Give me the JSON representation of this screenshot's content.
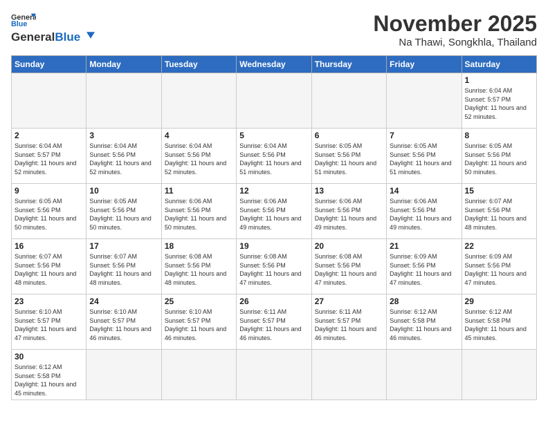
{
  "header": {
    "logo_general": "General",
    "logo_blue": "Blue",
    "month_year": "November 2025",
    "location": "Na Thawi, Songkhla, Thailand"
  },
  "weekdays": [
    "Sunday",
    "Monday",
    "Tuesday",
    "Wednesday",
    "Thursday",
    "Friday",
    "Saturday"
  ],
  "days": {
    "1": {
      "sunrise": "6:04 AM",
      "sunset": "5:57 PM",
      "daylight": "11 hours and 52 minutes."
    },
    "2": {
      "sunrise": "6:04 AM",
      "sunset": "5:57 PM",
      "daylight": "11 hours and 52 minutes."
    },
    "3": {
      "sunrise": "6:04 AM",
      "sunset": "5:56 PM",
      "daylight": "11 hours and 52 minutes."
    },
    "4": {
      "sunrise": "6:04 AM",
      "sunset": "5:56 PM",
      "daylight": "11 hours and 52 minutes."
    },
    "5": {
      "sunrise": "6:04 AM",
      "sunset": "5:56 PM",
      "daylight": "11 hours and 51 minutes."
    },
    "6": {
      "sunrise": "6:05 AM",
      "sunset": "5:56 PM",
      "daylight": "11 hours and 51 minutes."
    },
    "7": {
      "sunrise": "6:05 AM",
      "sunset": "5:56 PM",
      "daylight": "11 hours and 51 minutes."
    },
    "8": {
      "sunrise": "6:05 AM",
      "sunset": "5:56 PM",
      "daylight": "11 hours and 50 minutes."
    },
    "9": {
      "sunrise": "6:05 AM",
      "sunset": "5:56 PM",
      "daylight": "11 hours and 50 minutes."
    },
    "10": {
      "sunrise": "6:05 AM",
      "sunset": "5:56 PM",
      "daylight": "11 hours and 50 minutes."
    },
    "11": {
      "sunrise": "6:06 AM",
      "sunset": "5:56 PM",
      "daylight": "11 hours and 50 minutes."
    },
    "12": {
      "sunrise": "6:06 AM",
      "sunset": "5:56 PM",
      "daylight": "11 hours and 49 minutes."
    },
    "13": {
      "sunrise": "6:06 AM",
      "sunset": "5:56 PM",
      "daylight": "11 hours and 49 minutes."
    },
    "14": {
      "sunrise": "6:06 AM",
      "sunset": "5:56 PM",
      "daylight": "11 hours and 49 minutes."
    },
    "15": {
      "sunrise": "6:07 AM",
      "sunset": "5:56 PM",
      "daylight": "11 hours and 48 minutes."
    },
    "16": {
      "sunrise": "6:07 AM",
      "sunset": "5:56 PM",
      "daylight": "11 hours and 48 minutes."
    },
    "17": {
      "sunrise": "6:07 AM",
      "sunset": "5:56 PM",
      "daylight": "11 hours and 48 minutes."
    },
    "18": {
      "sunrise": "6:08 AM",
      "sunset": "5:56 PM",
      "daylight": "11 hours and 48 minutes."
    },
    "19": {
      "sunrise": "6:08 AM",
      "sunset": "5:56 PM",
      "daylight": "11 hours and 47 minutes."
    },
    "20": {
      "sunrise": "6:08 AM",
      "sunset": "5:56 PM",
      "daylight": "11 hours and 47 minutes."
    },
    "21": {
      "sunrise": "6:09 AM",
      "sunset": "5:56 PM",
      "daylight": "11 hours and 47 minutes."
    },
    "22": {
      "sunrise": "6:09 AM",
      "sunset": "5:56 PM",
      "daylight": "11 hours and 47 minutes."
    },
    "23": {
      "sunrise": "6:10 AM",
      "sunset": "5:57 PM",
      "daylight": "11 hours and 47 minutes."
    },
    "24": {
      "sunrise": "6:10 AM",
      "sunset": "5:57 PM",
      "daylight": "11 hours and 46 minutes."
    },
    "25": {
      "sunrise": "6:10 AM",
      "sunset": "5:57 PM",
      "daylight": "11 hours and 46 minutes."
    },
    "26": {
      "sunrise": "6:11 AM",
      "sunset": "5:57 PM",
      "daylight": "11 hours and 46 minutes."
    },
    "27": {
      "sunrise": "6:11 AM",
      "sunset": "5:57 PM",
      "daylight": "11 hours and 46 minutes."
    },
    "28": {
      "sunrise": "6:12 AM",
      "sunset": "5:58 PM",
      "daylight": "11 hours and 46 minutes."
    },
    "29": {
      "sunrise": "6:12 AM",
      "sunset": "5:58 PM",
      "daylight": "11 hours and 45 minutes."
    },
    "30": {
      "sunrise": "6:12 AM",
      "sunset": "5:58 PM",
      "daylight": "11 hours and 45 minutes."
    }
  }
}
